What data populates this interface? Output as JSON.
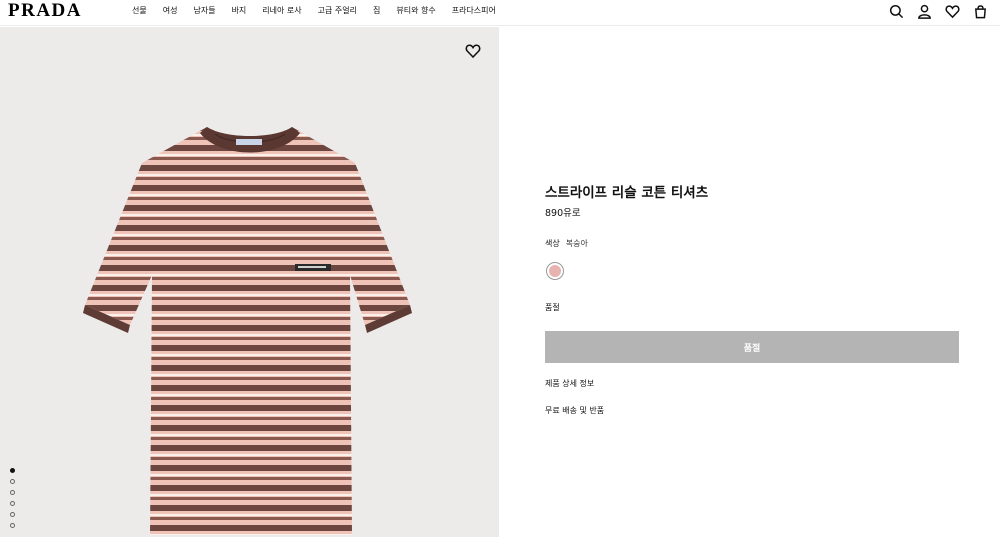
{
  "brand": {
    "logo": "PRADA"
  },
  "nav": {
    "items": [
      "선물",
      "여성",
      "남자들",
      "바지",
      "리네아 로사",
      "고급 주얼리",
      "집",
      "뷰티와 향수",
      "프라다스피어"
    ]
  },
  "header_actions": {
    "icons": [
      "search-icon",
      "account-icon",
      "wishlist-icon",
      "bag-icon"
    ]
  },
  "gallery": {
    "image_count": 6,
    "active_index": 0,
    "wishlist_icon": "heart-icon",
    "product_image": "striped-tshirt"
  },
  "product": {
    "title": "스트라이프 리슬 코튼 티셔츠",
    "price": "890유로",
    "color_label": "색상",
    "color_value": "복숭아",
    "swatch_color": "#e7b3b0",
    "size_label": "품절",
    "cta_label": "품절",
    "cta_color": "#b4b4b4",
    "details_link": "제품 상세 정보",
    "shipping_link": "무료 배송 및 반품"
  }
}
